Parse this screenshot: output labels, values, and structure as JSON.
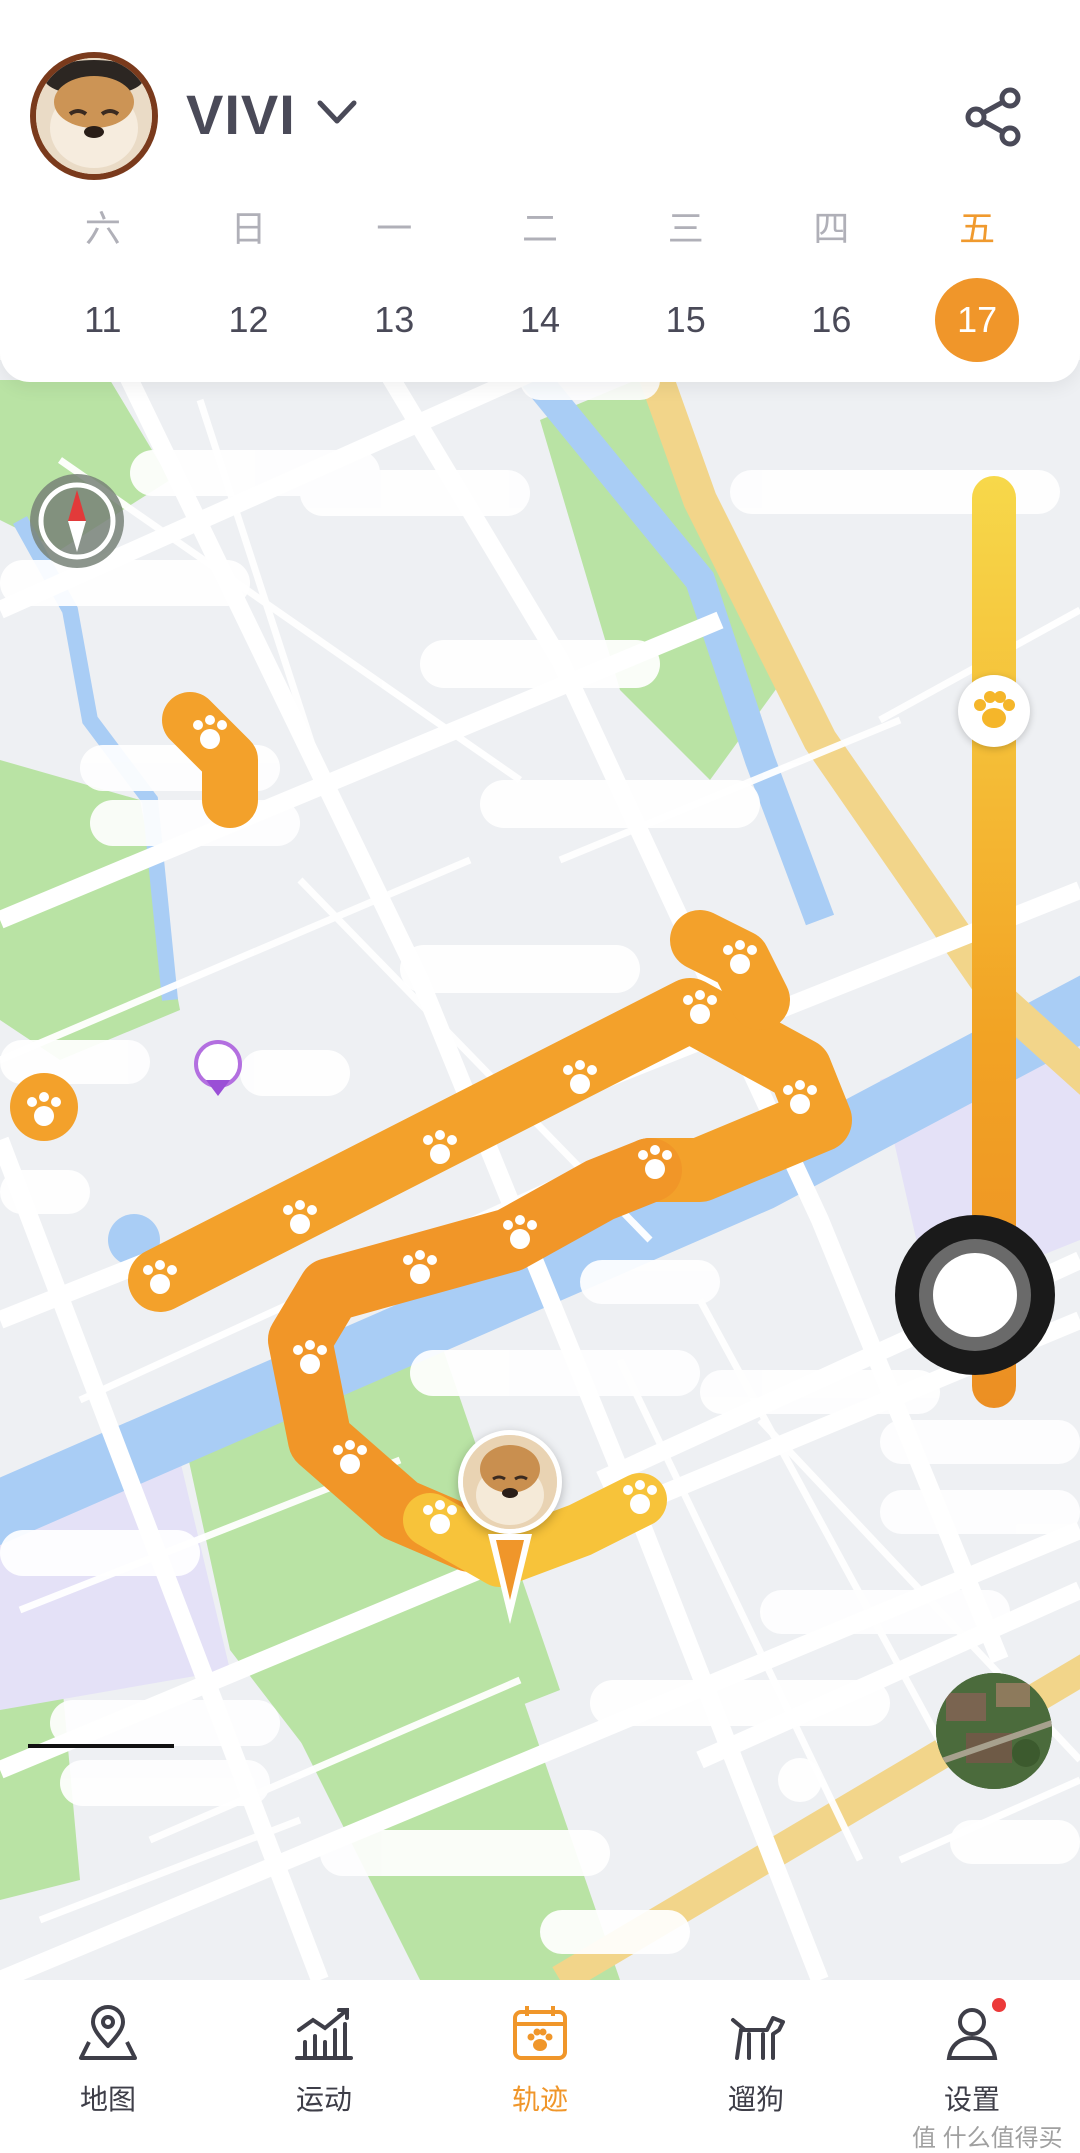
{
  "app": {
    "pet_name": "VIVI",
    "accent_color": "#f0962a",
    "track_color": "#f3a12b"
  },
  "header": {
    "weekdays": [
      "六",
      "日",
      "一",
      "二",
      "三",
      "四",
      "五"
    ],
    "dates": [
      "11",
      "12",
      "13",
      "14",
      "15",
      "16",
      "17"
    ],
    "selected_date": "17"
  },
  "map": {
    "icons": [
      "compass-icon",
      "paw-icon",
      "pet-location-marker",
      "satellite-view-toggle"
    ]
  },
  "nav": {
    "items": [
      {
        "label": "地图",
        "icon": "map-pin-icon"
      },
      {
        "label": "运动",
        "icon": "activity-chart-icon"
      },
      {
        "label": "轨迹",
        "icon": "calendar-paw-icon",
        "active": true
      },
      {
        "label": "遛狗",
        "icon": "dog-walk-icon"
      },
      {
        "label": "设置",
        "icon": "user-icon",
        "badge": true
      }
    ]
  },
  "watermark": "值 什么值得买"
}
